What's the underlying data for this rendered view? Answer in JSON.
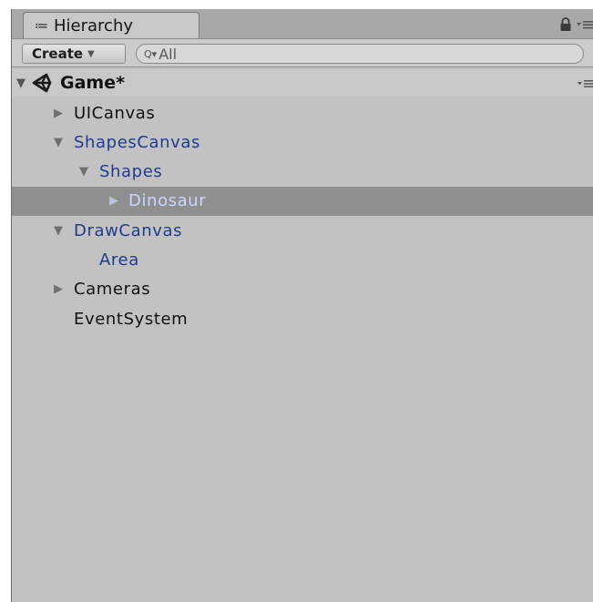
{
  "window": {
    "tab_icon": "≔",
    "tab_title": "Hierarchy",
    "lock_icon": "lock-icon",
    "menu_icon": "context-menu-icon"
  },
  "toolbar": {
    "create_label": "Create",
    "create_caret": "▼",
    "search_icon": "Q▾",
    "search_placeholder": "All"
  },
  "scene": {
    "label": "Game*",
    "arrow": "▼"
  },
  "tree": [
    {
      "label": "UICanvas",
      "arrow": "▶",
      "depth": 1,
      "style": "default"
    },
    {
      "label": "ShapesCanvas",
      "arrow": "▼",
      "depth": 1,
      "style": "prefab"
    },
    {
      "label": "Shapes",
      "arrow": "▼",
      "depth": 2,
      "style": "prefab"
    },
    {
      "label": "Dinosaur",
      "arrow": "▶",
      "depth": 3,
      "style": "selected"
    },
    {
      "label": "DrawCanvas",
      "arrow": "▼",
      "depth": 1,
      "style": "prefab"
    },
    {
      "label": "Area",
      "arrow": "",
      "depth": 2,
      "style": "prefab"
    },
    {
      "label": "Cameras",
      "arrow": "▶",
      "depth": 1,
      "style": "default"
    },
    {
      "label": "EventSystem",
      "arrow": "",
      "depth": 1,
      "style": "default"
    }
  ],
  "colors": {
    "panel_bg": "#c2c2c2",
    "selection_bg": "#8f8f8f",
    "prefab_text": "#1f3d8c",
    "selected_text": "#c9d6ff"
  }
}
